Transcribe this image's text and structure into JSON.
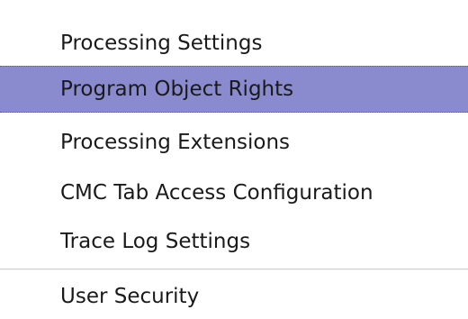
{
  "menu": {
    "items": [
      {
        "label": "Processing Settings"
      },
      {
        "label": "Program Object Rights",
        "selected": true
      },
      {
        "label": "Processing Extensions"
      },
      {
        "label": "CMC Tab Access Configuration"
      },
      {
        "label": "Trace Log Settings"
      },
      {
        "label": "User Security"
      }
    ],
    "selected_color": "#8a8acf"
  }
}
